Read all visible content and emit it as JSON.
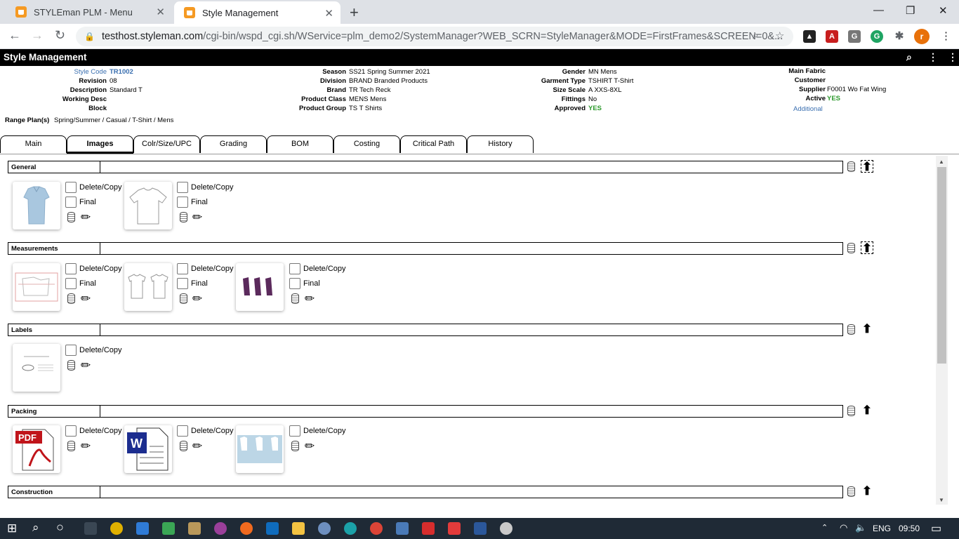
{
  "browser": {
    "tabs": [
      {
        "title": "STYLEman PLM - Menu",
        "active": false
      },
      {
        "title": "Style Management",
        "active": true
      }
    ],
    "url_host": "testhost.styleman.com",
    "url_path": "/cgi-bin/wspd_cgi.sh/WService=plm_demo2/SystemManager?WEB_SCRN=StyleManager&MODE=FirstFrames&SCREEN=0&...",
    "profile_initial": "r"
  },
  "app": {
    "title": "Style Management"
  },
  "info": {
    "col1": [
      {
        "label": "Style Code",
        "value": "TR1002",
        "style": "blue"
      },
      {
        "label": "Revision",
        "value": "08"
      },
      {
        "label": "Description",
        "value": "Standard T"
      },
      {
        "label": "Working Desc",
        "value": ""
      },
      {
        "label": "Block",
        "value": ""
      }
    ],
    "range_label": "Range Plan(s)",
    "range_value": "Spring/Summer / Casual / T-Shirt / Mens",
    "col2": [
      {
        "label": "Season",
        "value": "SS21 Spring Summer 2021"
      },
      {
        "label": "Division",
        "value": "BRAND Branded Products"
      },
      {
        "label": "Brand",
        "value": "TR Tech Reck"
      },
      {
        "label": "Product Class",
        "value": "MENS Mens"
      },
      {
        "label": "Product Group",
        "value": "TS T Shirts"
      }
    ],
    "col3": [
      {
        "label": "Gender",
        "value": "MN Mens"
      },
      {
        "label": "Garment Type",
        "value": "TSHIRT T-Shirt"
      },
      {
        "label": "Size Scale",
        "value": "A XXS-8XL"
      },
      {
        "label": "Fittings",
        "value": "No"
      },
      {
        "label": "Approved",
        "value": "YES",
        "style": "green"
      }
    ],
    "col4": [
      {
        "label": "Main Fabric",
        "value": ""
      },
      {
        "label": "Customer",
        "value": ""
      },
      {
        "label": "Supplier",
        "value": "F0001 Wo Fat Wing"
      },
      {
        "label": "Active",
        "value": "YES",
        "style": "green"
      }
    ],
    "additional_link": "Additional"
  },
  "tabs": [
    "Main",
    "Images",
    "Colr/Size/UPC",
    "Grading",
    "BOM",
    "Costing",
    "Critical Path",
    "History"
  ],
  "active_tab": "Images",
  "labels": {
    "delete_copy": "Delete/Copy",
    "final": "Final"
  },
  "sections": [
    {
      "name": "General"
    },
    {
      "name": "Measurements"
    },
    {
      "name": "Labels"
    },
    {
      "name": "Packing"
    },
    {
      "name": "Construction"
    }
  ],
  "taskbar": {
    "language": "ENG",
    "time": "09:50"
  },
  "colors": {
    "accent_orange": "#f59a23",
    "label_blue": "#3a6fb0",
    "status_green": "#2e9a2e"
  }
}
